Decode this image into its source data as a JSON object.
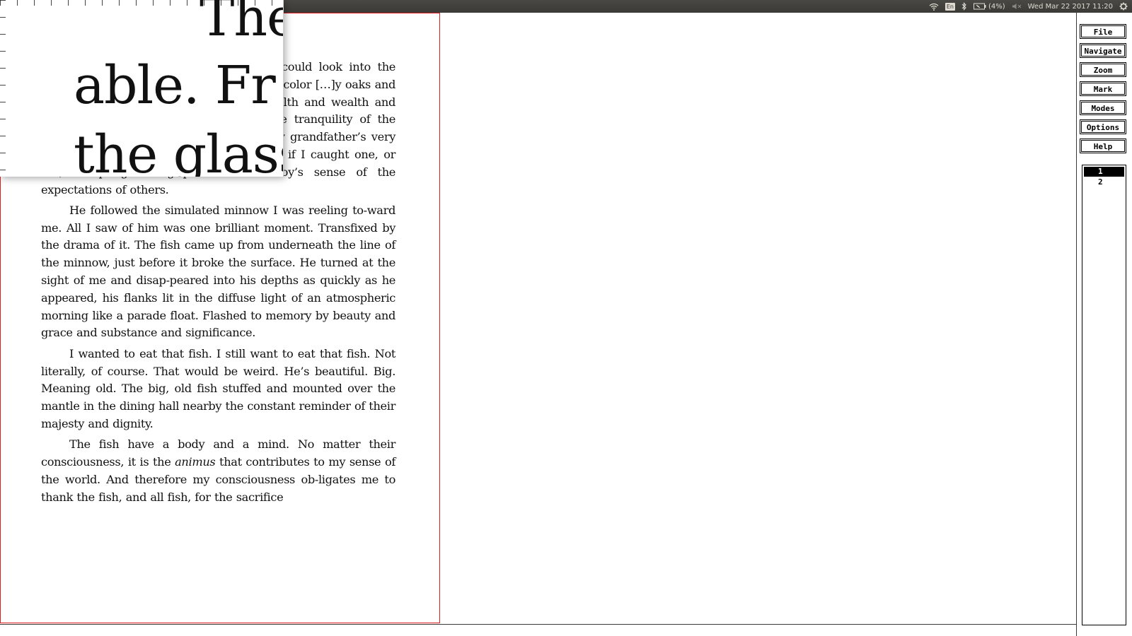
{
  "topbar": {
    "keyboard_layout": "En",
    "battery_text": "(4%)",
    "datetime": "Wed Mar 22 2017 11:20",
    "icons": [
      "wifi-icon",
      "keyboard-layout-icon",
      "bluetooth-icon",
      "battery-icon",
      "volume-muted-icon",
      "settings-gear-icon"
    ]
  },
  "magnifier": {
    "lines": [
      "The",
      "able.  Fr",
      "the glass"
    ]
  },
  "document": {
    "paragraphs": [
      {
        "text": "[…]d chill and breath-able. From […] I could look into the glass […] I cast my plastic […] a brownish color […]y oaks and pines […]ers held in moun-[…]nse of health and wealth and body and mind. The spirit flew over the tranquility of the moment as I sat there, a boy alone in my grandfather’s very nice little dingy, fishing. I could care less if I caught one, or not, excepting the grip held of a boy’s sense of the expectations of others."
      },
      {
        "text": "He followed the simulated minnow I was reeling to-ward me. All I saw of him was one brilliant moment. Transfixed by the drama of it. The fish came up from underneath the line of the minnow, just before it broke the surface. He turned at the sight of me and disap-peared into his depths as quickly as he appeared, his flanks lit in the diffuse light of an atmospheric morning like a parade float. Flashed to memory by beauty and grace and substance and significance."
      },
      {
        "text": "I wanted to eat that fish. I still want to eat that fish. Not literally, of course. That would be weird. He’s beautiful. Big. Meaning old. The big, old fish stuffed and mounted over the mantle in the dining hall nearby the constant reminder of their majesty and dignity."
      },
      {
        "before": "The fish have a body and a mind. No matter their consciousness, it is the ",
        "emph": "animus",
        "after": " that contributes to my sense of the world. And therefore my consciousness ob-ligates me to thank the fish, and all fish, for the sacrifice"
      }
    ]
  },
  "menu": {
    "file": "File",
    "navigate": "Navigate",
    "zoom": "Zoom",
    "mark": "Mark",
    "modes": "Modes",
    "options": "Options",
    "help": "Help"
  },
  "pages": {
    "items": [
      "1",
      "2"
    ],
    "selected": "1"
  },
  "colors": {
    "page_border": "#e02020",
    "topbar": "#3b3a36"
  }
}
